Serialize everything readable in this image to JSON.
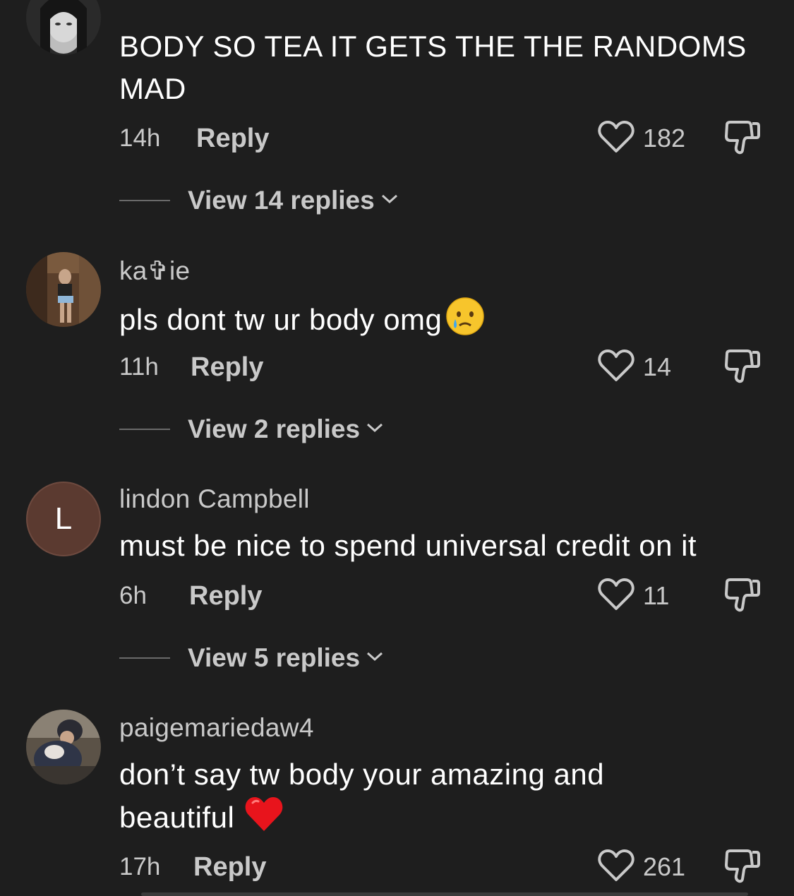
{
  "comments": [
    {
      "username": "",
      "text": "BODY SO TEA IT GETS THE THE RANDOMS MAD",
      "time": "14h",
      "reply_label": "Reply",
      "likes": "182",
      "view_replies": "View 14 replies"
    },
    {
      "username": "ka✞ie",
      "text": "pls dont tw ur body omg",
      "emoji": "crying-face-emoji",
      "time": "11h",
      "reply_label": "Reply",
      "likes": "14",
      "view_replies": "View 2 replies"
    },
    {
      "username": "lindon Campbell",
      "avatar_letter": "L",
      "text": "must be nice to spend universal credit on it",
      "time": "6h",
      "reply_label": "Reply",
      "likes": "11",
      "view_replies": "View 5 replies"
    },
    {
      "username": "paigemariedaw4",
      "text": "don’t say tw body your amazing and beautiful",
      "emoji": "red-heart-emoji",
      "time": "17h",
      "reply_label": "Reply",
      "likes": "261"
    }
  ],
  "colors": {
    "background": "#1e1e1e",
    "primary_text": "#ffffff",
    "secondary_text": "#c9c9c9",
    "letter_avatar": "#5b3a30"
  }
}
